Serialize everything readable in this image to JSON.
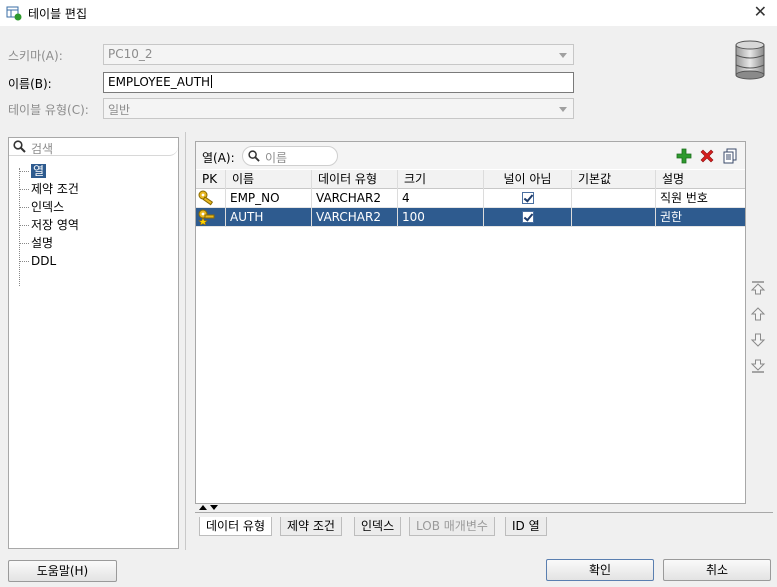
{
  "window": {
    "title": "테이블 편집",
    "close_glyph": "✕"
  },
  "form": {
    "schema_label": "스키마(A):",
    "schema_value": "PC10_2",
    "name_label": "이름(B):",
    "name_value": "EMPLOYEE_AUTH",
    "table_type_label": "테이블 유형(C):",
    "table_type_value": "일반"
  },
  "left_panel": {
    "search_placeholder": "검색",
    "tree": [
      "열",
      "제약 조건",
      "인덱스",
      "저장 영역",
      "설명",
      "DDL"
    ]
  },
  "columns_panel": {
    "label": "열(A):",
    "search_placeholder": "이름",
    "headers": [
      "PK",
      "이름",
      "데이터 유형",
      "크기",
      "널이 아님",
      "기본값",
      "설명"
    ],
    "rows": [
      {
        "pk": "key-icon",
        "name": "EMP_NO",
        "type": "VARCHAR2",
        "size": "4",
        "not_null": true,
        "default": "",
        "comment": "직원 번호"
      },
      {
        "pk": "key-star-icon",
        "name": "AUTH",
        "type": "VARCHAR2",
        "size": "100",
        "not_null": true,
        "default": "",
        "comment": "권한"
      }
    ]
  },
  "bottom_tabs": [
    "데이터 유형",
    "제약 조건",
    "인덱스",
    "LOB 매개변수",
    "ID 열"
  ],
  "buttons": {
    "help": "도움말(H)",
    "ok": "확인",
    "cancel": "취소"
  },
  "colors": {
    "selection": "#2e5b8f",
    "add": "#2e9a2e",
    "delete": "#d62020"
  }
}
